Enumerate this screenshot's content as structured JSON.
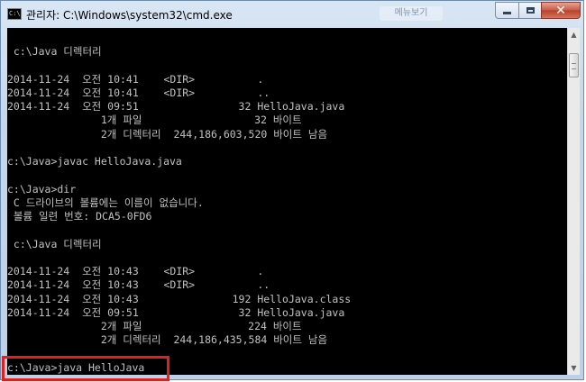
{
  "window": {
    "title": "관리자: C:\\Windows\\system32\\cmd.exe",
    "faded_tab": "메뉴보기",
    "icon_text": "C:\\."
  },
  "controls": {
    "minimize": "minimize-icon",
    "maximize": "maximize-icon",
    "close": "close-icon",
    "close_glyph": "✕"
  },
  "console": {
    "lines": [
      " c:\\Java 디렉터리",
      "",
      "2014-11-24  오전 10:41    <DIR>          .",
      "2014-11-24  오전 10:41    <DIR>          ..",
      "2014-11-24  오전 09:51                32 HelloJava.java",
      "               1개 파일                  32 바이트",
      "               2개 디렉터리  244,186,603,520 바이트 남음",
      "",
      "c:\\Java>javac HelloJava.java",
      "",
      "c:\\Java>dir",
      " C 드라이브의 볼륨에는 이름이 없습니다.",
      " 볼륨 일련 번호: DCA5-0FD6",
      "",
      " c:\\Java 디렉터리",
      "",
      "2014-11-24  오전 10:43    <DIR>          .",
      "2014-11-24  오전 10:43    <DIR>          ..",
      "2014-11-24  오전 10:43               192 HelloJava.class",
      "2014-11-24  오전 09:51                32 HelloJava.java",
      "               2개 파일                 224 바이트",
      "               2개 디렉터리  244,186,435,584 바이트 남음",
      "",
      "c:\\Java>java HelloJava"
    ]
  },
  "scrollbar": {
    "up_glyph": "▲",
    "down_glyph": "▼"
  },
  "colors": {
    "console_bg": "#000000",
    "console_text": "#c0c0c0",
    "highlight": "#e0201e"
  }
}
